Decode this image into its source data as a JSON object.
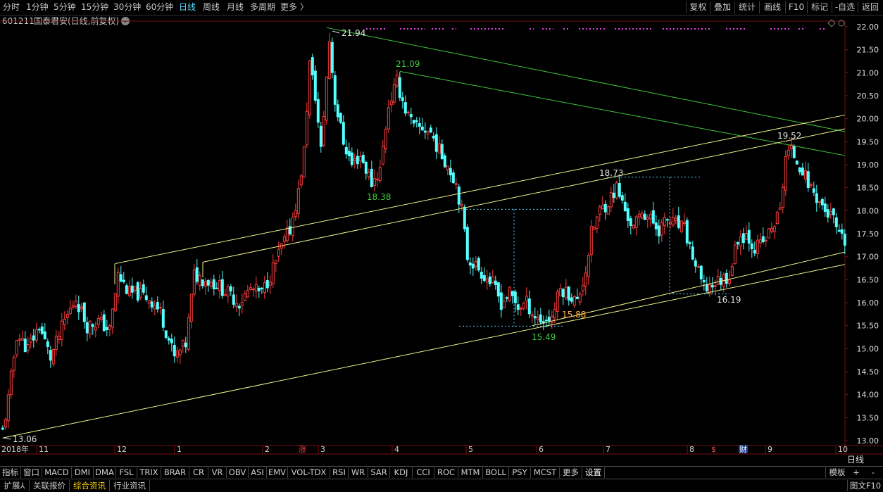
{
  "toolbar": {
    "periods": [
      "分时",
      "1分钟",
      "5分钟",
      "15分钟",
      "30分钟",
      "60分钟",
      "日线",
      "周线",
      "月线",
      "多周期",
      "更多 〉"
    ],
    "active_period": "日线",
    "right_buttons": [
      "复权",
      "叠加",
      "统计",
      "画线",
      "F10",
      "标记",
      "-自选",
      "返回"
    ]
  },
  "info": {
    "code": "601211",
    "name": "国泰君安(日线,前复权)"
  },
  "right_axis": {
    "ticks": [
      "22.00",
      "21.50",
      "21.00",
      "20.50",
      "20.00",
      "19.50",
      "19.00",
      "18.50",
      "18.00",
      "17.50",
      "17.00",
      "16.50",
      "16.00",
      "15.50",
      "15.00",
      "14.50",
      "14.00",
      "13.50",
      "13.00"
    ],
    "unit_label": "日线"
  },
  "x_axis": {
    "year_label": "2018年",
    "month_labels": [
      "11",
      "12",
      "1",
      "2",
      "3",
      "4",
      "5",
      "6",
      "7",
      "8",
      "9",
      "10"
    ]
  },
  "markers": {
    "limit_up": "涨",
    "dividend": "$",
    "finance": "财"
  },
  "colors": {
    "up": "#ff3c3c",
    "down": "#54ffff",
    "trend_green": "#3ec83e",
    "trend_yellow": "#f0f08c",
    "grid": "#7a1010",
    "axis_text": "#e0e0e0",
    "marker_text": "#ff3c3c"
  },
  "indicator_tabs": [
    "指标",
    "窗口",
    "MACD",
    "DMI",
    "DMA",
    "FSL",
    "TRIX",
    "BRAR",
    "CR",
    "VR",
    "OBV",
    "ASI",
    "EMV",
    "VOL-TDX",
    "RSI",
    "WR",
    "SAR",
    "KDJ",
    "CCI",
    "ROC",
    "MTM",
    "BOLL",
    "PSY",
    "MCST",
    "更多",
    "设置"
  ],
  "indicator_right": [
    "模板",
    "+",
    "-"
  ],
  "bottom_tabs": [
    "扩展⅄",
    "关联报价",
    "综合资讯",
    "行业资讯"
  ],
  "bottom_selected": "综合资讯",
  "bottom_right": "图文F10",
  "chart_data": {
    "type": "candlestick",
    "y_range": [
      12.85,
      22.15
    ],
    "y_ticks": [
      22.0,
      21.5,
      21.0,
      20.5,
      20.0,
      19.5,
      19.0,
      18.5,
      18.0,
      17.5,
      17.0,
      16.5,
      16.0,
      15.5,
      15.0,
      14.5,
      14.0,
      13.5,
      13.0
    ],
    "key_prices": {
      "low_2018": "13.06",
      "high_feb": "21.94",
      "high_apr": "21.09",
      "low_mar": "18.38",
      "high_jul": "18.73",
      "low_jun": "15.49",
      "low_jun_b": "15.88",
      "low_aug": "16.19",
      "high_sep": "19.52"
    },
    "anchors": [
      {
        "d": 0,
        "p": 13.2
      },
      {
        "d": 2,
        "p": 13.9
      },
      {
        "d": 5,
        "p": 15.3
      },
      {
        "d": 9,
        "p": 15.0
      },
      {
        "d": 13,
        "p": 15.5
      },
      {
        "d": 17,
        "p": 14.8
      },
      {
        "d": 22,
        "p": 15.6
      },
      {
        "d": 26,
        "p": 16.1
      },
      {
        "d": 30,
        "p": 15.5
      },
      {
        "d": 34,
        "p": 15.6
      },
      {
        "d": 38,
        "p": 15.4
      },
      {
        "d": 41,
        "p": 16.6
      },
      {
        "d": 45,
        "p": 16.2
      },
      {
        "d": 48,
        "p": 16.2
      },
      {
        "d": 52,
        "p": 16.1
      },
      {
        "d": 56,
        "p": 15.8
      },
      {
        "d": 61,
        "p": 14.8
      },
      {
        "d": 65,
        "p": 15.1
      },
      {
        "d": 68,
        "p": 16.6
      },
      {
        "d": 72,
        "p": 16.5
      },
      {
        "d": 76,
        "p": 16.4
      },
      {
        "d": 80,
        "p": 16.2
      },
      {
        "d": 84,
        "p": 16.0
      },
      {
        "d": 88,
        "p": 16.3
      },
      {
        "d": 92,
        "p": 16.2
      },
      {
        "d": 95,
        "p": 16.6
      },
      {
        "d": 99,
        "p": 17.2
      },
      {
        "d": 102,
        "p": 17.6
      },
      {
        "d": 105,
        "p": 18.4
      },
      {
        "d": 107,
        "p": 19.3
      },
      {
        "d": 109,
        "p": 21.2
      },
      {
        "d": 111,
        "p": 20.5
      },
      {
        "d": 113,
        "p": 19.3
      },
      {
        "d": 116,
        "p": 21.7
      },
      {
        "d": 118,
        "p": 20.4
      },
      {
        "d": 121,
        "p": 19.5
      },
      {
        "d": 124,
        "p": 19.0
      },
      {
        "d": 127,
        "p": 19.2
      },
      {
        "d": 131,
        "p": 18.6
      },
      {
        "d": 134,
        "p": 18.9
      },
      {
        "d": 137,
        "p": 20.3
      },
      {
        "d": 140,
        "p": 20.8
      },
      {
        "d": 143,
        "p": 20.2
      },
      {
        "d": 146,
        "p": 19.8
      },
      {
        "d": 149,
        "p": 19.8
      },
      {
        "d": 152,
        "p": 19.7
      },
      {
        "d": 155,
        "p": 19.3
      },
      {
        "d": 158,
        "p": 19.0
      },
      {
        "d": 161,
        "p": 18.6
      },
      {
        "d": 163,
        "p": 18.0
      },
      {
        "d": 165,
        "p": 17.0
      },
      {
        "d": 168,
        "p": 16.8
      },
      {
        "d": 171,
        "p": 16.6
      },
      {
        "d": 174,
        "p": 16.4
      },
      {
        "d": 177,
        "p": 16.0
      },
      {
        "d": 180,
        "p": 16.2
      },
      {
        "d": 183,
        "p": 15.9
      },
      {
        "d": 186,
        "p": 16.0
      },
      {
        "d": 189,
        "p": 15.7
      },
      {
        "d": 192,
        "p": 15.6
      },
      {
        "d": 195,
        "p": 15.7
      },
      {
        "d": 198,
        "p": 16.3
      },
      {
        "d": 201,
        "p": 16.2
      },
      {
        "d": 204,
        "p": 16.0
      },
      {
        "d": 207,
        "p": 16.7
      },
      {
        "d": 209,
        "p": 17.5
      },
      {
        "d": 212,
        "p": 18.0
      },
      {
        "d": 215,
        "p": 18.2
      },
      {
        "d": 218,
        "p": 18.5
      },
      {
        "d": 221,
        "p": 18.0
      },
      {
        "d": 224,
        "p": 17.6
      },
      {
        "d": 227,
        "p": 18.0
      },
      {
        "d": 230,
        "p": 17.8
      },
      {
        "d": 233,
        "p": 17.6
      },
      {
        "d": 236,
        "p": 17.8
      },
      {
        "d": 239,
        "p": 17.7
      },
      {
        "d": 242,
        "p": 17.6
      },
      {
        "d": 246,
        "p": 16.8
      },
      {
        "d": 249,
        "p": 16.3
      },
      {
        "d": 252,
        "p": 16.4
      },
      {
        "d": 255,
        "p": 16.5
      },
      {
        "d": 258,
        "p": 16.6
      },
      {
        "d": 261,
        "p": 17.4
      },
      {
        "d": 264,
        "p": 17.5
      },
      {
        "d": 267,
        "p": 17.2
      },
      {
        "d": 270,
        "p": 17.3
      },
      {
        "d": 273,
        "p": 17.6
      },
      {
        "d": 276,
        "p": 18.0
      },
      {
        "d": 278,
        "p": 19.2
      },
      {
        "d": 280,
        "p": 19.3
      },
      {
        "d": 283,
        "p": 19.0
      },
      {
        "d": 286,
        "p": 18.6
      },
      {
        "d": 289,
        "p": 18.3
      },
      {
        "d": 292,
        "p": 18.0
      },
      {
        "d": 295,
        "p": 17.8
      },
      {
        "d": 297,
        "p": 17.4
      },
      {
        "d": 299,
        "p": 17.3
      }
    ],
    "trendlines": [
      {
        "color": "green",
        "from": {
          "d": 115,
          "p": 21.98
        },
        "to": {
          "d": 299,
          "p": 19.72
        }
      },
      {
        "color": "green",
        "from": {
          "d": 141,
          "p": 21.03
        },
        "to": {
          "d": 299,
          "p": 19.2
        }
      },
      {
        "color": "yellow",
        "from": {
          "d": 40,
          "p": 16.85
        },
        "to": {
          "d": 299,
          "p": 20.08
        }
      },
      {
        "color": "yellow",
        "from": {
          "d": 71,
          "p": 16.88
        },
        "to": {
          "d": 299,
          "p": 19.78
        }
      },
      {
        "color": "yellow",
        "from": {
          "d": 0,
          "p": 13.06
        },
        "to": {
          "d": 299,
          "p": 16.83
        }
      },
      {
        "color": "yellow",
        "from": {
          "d": 188,
          "p": 15.5
        },
        "to": {
          "d": 299,
          "p": 17.1
        }
      }
    ]
  }
}
